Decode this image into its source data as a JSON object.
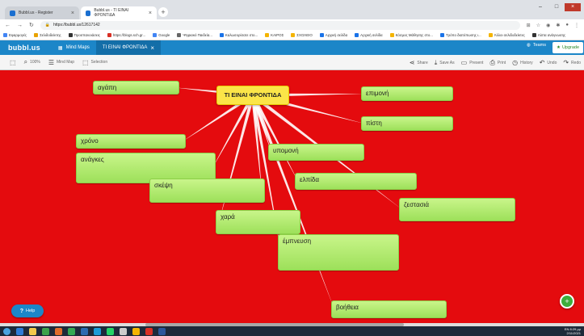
{
  "browser": {
    "tabs": [
      {
        "label": "Bubbl.us - Register"
      },
      {
        "label": "Bubbl.us - ΤΙ ΕΙΝΑΙ ΦΡΟΝΤΙΔΑ"
      }
    ],
    "url": "https://bubbl.us/12617142",
    "bookmarks": [
      {
        "label": "Εφαρμογές",
        "color": "#4285f4"
      },
      {
        "label": "Σελιδοδείκτης",
        "color": "#e8a200"
      },
      {
        "label": "Προσπανοιάσεις",
        "color": "#333333"
      },
      {
        "label": "https://blogs.sch.gr...",
        "color": "#d93025"
      },
      {
        "label": "Google",
        "color": "#4285f4"
      },
      {
        "label": "Ψηφιακό Παιδεία...",
        "color": "#666666"
      },
      {
        "label": "Καλωσορίσατε στο...",
        "color": "#1a73e8"
      },
      {
        "label": "ΚΑΙΡΟΣ",
        "color": "#f4b400"
      },
      {
        "label": "ΣΧΟΛΕΙΟ",
        "color": "#f4b400"
      },
      {
        "label": "Αρχική σελίδα",
        "color": "#1a73e8"
      },
      {
        "label": "Αρχική σελίδα",
        "color": "#1a73e8"
      },
      {
        "label": "Κόσμος Μάθησης στο...",
        "color": "#f4b400"
      },
      {
        "label": "Τρόπο διατύπωσης ι...",
        "color": "#1a73e8"
      },
      {
        "label": "Άλλοι σελιδοδείκτες",
        "color": "#f4b400"
      },
      {
        "label": "Λίστα ανάγνωσης",
        "color": "#333333"
      }
    ]
  },
  "app": {
    "logo": "bubbl.us",
    "mindmaps_label": "Mind Maps",
    "active_tab": "ΤΙ ΕΙΝΑΙ ΦΡΟΝΤΙΔΑ",
    "teams_label": "Teams",
    "upgrade_label": "Upgrade"
  },
  "toolbar": {
    "zoom": "100%",
    "mindmap_label": "Mind Map",
    "selection_label": "Selection",
    "share_label": "Share",
    "saveas_label": "Save As",
    "present_label": "Present",
    "print_label": "Print",
    "history_label": "History",
    "undo_label": "Undo",
    "redo_label": "Redo"
  },
  "mindmap": {
    "root": "ΤΙ ΕΙΝΑΙ ΦΡΟΝΤΙΔΑ",
    "nodes": [
      {
        "label": "αγάπη"
      },
      {
        "label": "επιμονή"
      },
      {
        "label": "πίστη"
      },
      {
        "label": "χρόνο"
      },
      {
        "label": "ανάγκες"
      },
      {
        "label": "υπομονή"
      },
      {
        "label": "ελπίδα"
      },
      {
        "label": "σκέψη"
      },
      {
        "label": "ζεστασιά"
      },
      {
        "label": "χαρά"
      },
      {
        "label": "έμπνευση"
      },
      {
        "label": "βοήθεια"
      }
    ]
  },
  "help_label": "Help",
  "tray": {
    "time": "8:29 μμ",
    "date": "2/11/2021",
    "lang": "EN"
  }
}
